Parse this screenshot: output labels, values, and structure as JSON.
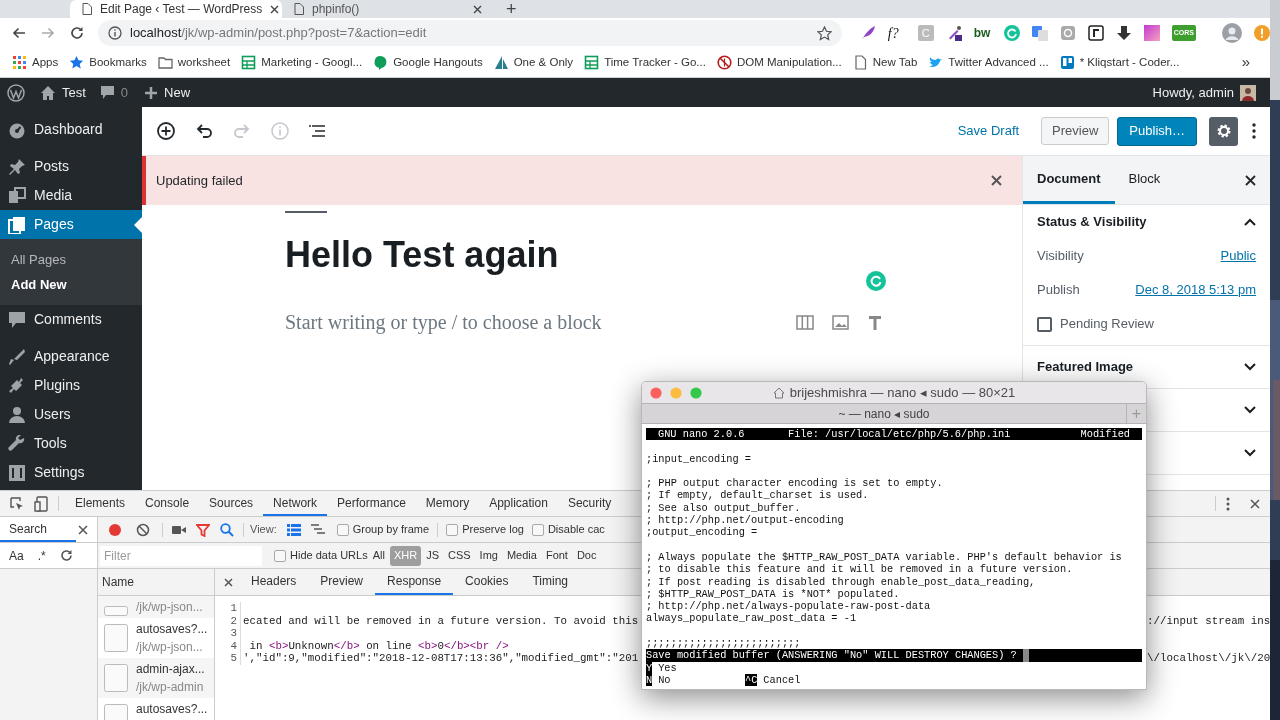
{
  "browser": {
    "tabs": [
      {
        "title": "Edit Page ‹ Test — WordPress",
        "selected": true
      },
      {
        "title": "phpinfo()",
        "selected": false
      }
    ],
    "new_tab": "+",
    "url": {
      "host": "localhost",
      "path": "/jk/wp-admin/post.php?post=7&action=edit"
    },
    "extension_labels": [
      "f?",
      "C",
      "bw",
      "CORS"
    ],
    "bookmarks": [
      "Apps",
      "Bookmarks",
      "worksheet",
      "Marketing - Googl...",
      "Google Hangouts",
      "One & Only",
      "Time Tracker - Go...",
      "DOM Manipulation...",
      "New Tab",
      "Twitter Advanced ...",
      "* Kliqstart - Coder..."
    ],
    "bookmarks_more": "»"
  },
  "admin_bar": {
    "site": "Test",
    "comments": "0",
    "new": "New",
    "greeting": "Howdy, admin"
  },
  "menu_groups": [
    [
      {
        "label": "Dashboard",
        "selected": false
      }
    ],
    [
      {
        "label": "Posts",
        "selected": false
      },
      {
        "label": "Media",
        "selected": false
      },
      {
        "label": "Pages",
        "selected": true,
        "children": [
          {
            "label": "All Pages",
            "selected": false
          },
          {
            "label": "Add New",
            "selected": true
          }
        ]
      },
      {
        "label": "Comments",
        "selected": false
      }
    ],
    [
      {
        "label": "Appearance",
        "selected": false
      },
      {
        "label": "Plugins",
        "selected": false
      },
      {
        "label": "Users",
        "selected": false
      },
      {
        "label": "Tools",
        "selected": false
      },
      {
        "label": "Settings",
        "selected": false
      }
    ]
  ],
  "editor": {
    "tools": [
      {
        "disabled": false
      },
      {
        "disabled": false
      },
      {
        "disabled": true
      },
      {
        "disabled": true
      },
      {
        "disabled": false
      }
    ],
    "save_draft": "Save Draft",
    "preview": "Preview",
    "publish": "Publish…",
    "settings_open": true,
    "notice": "Updating failed",
    "title": "Hello Test again",
    "placeholder": "Start writing or type / to choose a block"
  },
  "settings_sidebar": {
    "tabs": [
      {
        "label": "Document",
        "selected": true
      },
      {
        "label": "Block",
        "selected": false
      }
    ],
    "panels": [
      {
        "title": "Status & Visibility",
        "expanded": true,
        "rows": [
          {
            "kind": "link",
            "label": "Visibility",
            "value": "Public"
          },
          {
            "kind": "link",
            "label": "Publish",
            "value": "Dec 8, 2018 5:13 pm"
          },
          {
            "kind": "checkbox",
            "label": "Pending Review",
            "checked": false
          }
        ]
      },
      {
        "title": "Featured Image",
        "expanded": false
      },
      {
        "expanded": false
      },
      {
        "expanded": false
      }
    ]
  },
  "devtools": {
    "panels": [
      {
        "label": "Elements",
        "selected": false
      },
      {
        "label": "Console",
        "selected": false
      },
      {
        "label": "Sources",
        "selected": false
      },
      {
        "label": "Network",
        "selected": true
      },
      {
        "label": "Performance",
        "selected": false
      },
      {
        "label": "Memory",
        "selected": false
      },
      {
        "label": "Application",
        "selected": false
      },
      {
        "label": "Security",
        "selected": false
      }
    ],
    "search_tab": "Search",
    "search_options": [
      "Aa",
      ".*"
    ],
    "view_label": "View:",
    "options": [
      {
        "label": "Group by frame",
        "checked": false
      },
      {
        "label": "Preserve log",
        "checked": false
      },
      {
        "label": "Disable cac",
        "checked": false
      }
    ],
    "filter_placeholder": "Filter",
    "hide_data_urls": {
      "label": "Hide data URLs",
      "checked": false
    },
    "types": [
      {
        "label": "All",
        "selected": false
      },
      {
        "label": "XHR",
        "selected": true
      },
      {
        "label": "JS",
        "selected": false
      },
      {
        "label": "CSS",
        "selected": false
      },
      {
        "label": "Img",
        "selected": false
      },
      {
        "label": "Media",
        "selected": false
      },
      {
        "label": "Font",
        "selected": false
      },
      {
        "label": "Doc",
        "selected": false
      }
    ],
    "name_header": "Name",
    "requests": [
      {
        "path": "/jk/wp-json..."
      },
      {
        "name": "autosaves?...",
        "path": "/jk/wp-json..."
      },
      {
        "name": "admin-ajax...",
        "path": "/jk/wp-admin"
      },
      {
        "name": "autosaves?..."
      }
    ],
    "detail_tabs": [
      {
        "label": "Headers",
        "selected": false
      },
      {
        "label": "Preview",
        "selected": false
      },
      {
        "label": "Response",
        "selected": true
      },
      {
        "label": "Cookies",
        "selected": false
      },
      {
        "label": "Timing",
        "selected": false
      }
    ],
    "response_lines": [
      {
        "number": "1"
      },
      {
        "number": "2",
        "tokens": [
          {
            "kind": "text",
            "text": "ecated and will be removed in a future version. To avoid this"
          }
        ],
        "text_after": "://input stream ins"
      },
      {
        "number": "3"
      },
      {
        "number": "4",
        "tokens": [
          {
            "kind": "text",
            "text": " in "
          },
          {
            "kind": "tag",
            "text": "<b>"
          },
          {
            "kind": "text",
            "text": "Unknown"
          },
          {
            "kind": "tag",
            "text": "</b>"
          },
          {
            "kind": "text",
            "text": " on line "
          },
          {
            "kind": "tag",
            "text": "<b>"
          },
          {
            "kind": "text",
            "text": "0"
          },
          {
            "kind": "tag",
            "text": "</b><br />"
          }
        ]
      },
      {
        "number": "5",
        "tokens": [
          {
            "kind": "text",
            "text": "',\"id\":9,\"modified\":\"2018-12-08T17:13:36\",\"modified_gmt\":\"201"
          }
        ],
        "text_after": "\\/localhost\\/jk\\/20"
      }
    ]
  },
  "terminal": {
    "title": "brijeshmishra — nano ◂ sudo — 80×21",
    "tab": "~ — nano ◂ sudo",
    "new_tab": "+",
    "header": {
      "version": "GNU nano 2.0.6",
      "file": "File: /usr/local/etc/php/5.6/php.ini",
      "status": "Modified"
    },
    "paragraphs": [
      [
        ";input_encoding ="
      ],
      [
        "; PHP output character encoding is set to empty.",
        "; If empty, default_charset is used.",
        "; See also output_buffer.",
        "; http://php.net/output-encoding",
        ";output_encoding ="
      ],
      [
        "; Always populate the $HTTP_RAW_POST_DATA variable. PHP's default behavior is",
        "; to disable this feature and it will be removed in a future version.",
        "; If post reading is disabled through enable_post_data_reading,",
        "; $HTTP_RAW_POST_DATA is *NOT* populated.",
        "; http://php.net/always-populate-raw-post-data",
        "always_populate_raw_post_data = -1"
      ],
      [
        ";;;;;;;;;;;;;;;;;;;;;;;;;"
      ]
    ],
    "prompt": "Save modified buffer (ANSWERING \"No\" WILL DESTROY CHANGES) ?",
    "shortcuts": [
      [
        {
          "key": "Y",
          "label": "Yes"
        }
      ],
      [
        {
          "key": "N",
          "label": "No"
        },
        {
          "key": "^C",
          "label": "Cancel"
        }
      ]
    ]
  }
}
